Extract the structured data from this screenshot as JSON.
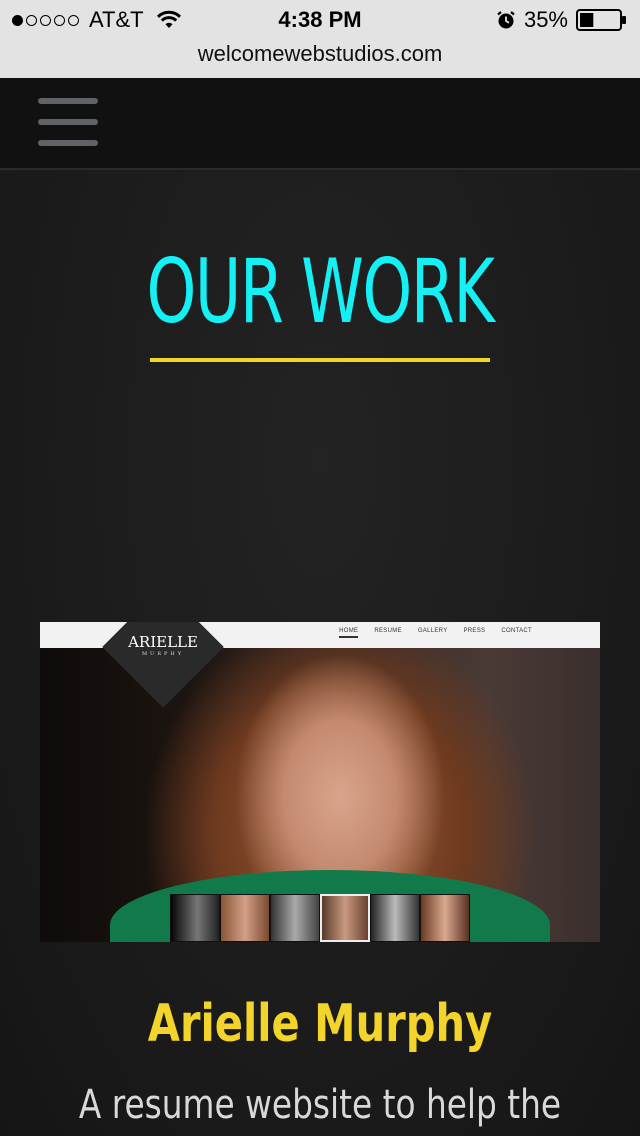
{
  "status_bar": {
    "carrier": "AT&T",
    "signal_bars_filled": 1,
    "signal_bars_total": 5,
    "time": "4:38 PM",
    "battery_percent": "35%",
    "battery_level": 0.35,
    "icons": [
      "wifi-icon",
      "alarm-icon",
      "battery-icon"
    ]
  },
  "browser": {
    "url": "welcomewebstudios.com"
  },
  "nav": {
    "menu_icon": "hamburger-menu-icon"
  },
  "section": {
    "title": "OUR WORK"
  },
  "project": {
    "screenshot": {
      "logo_title": "ARIELLE",
      "logo_subtitle": "MURPHY",
      "nav_items": [
        "HOME",
        "RESUME",
        "GALLERY",
        "PRESS",
        "CONTACT"
      ],
      "active_nav": "HOME"
    },
    "name": "Arielle Murphy",
    "description": "A resume website to help the"
  },
  "colors": {
    "title": "#14f0f4",
    "underline": "#f2d42a",
    "project_name": "#f2d42a",
    "background": "#1b1b1b",
    "navbar": "#111111"
  }
}
